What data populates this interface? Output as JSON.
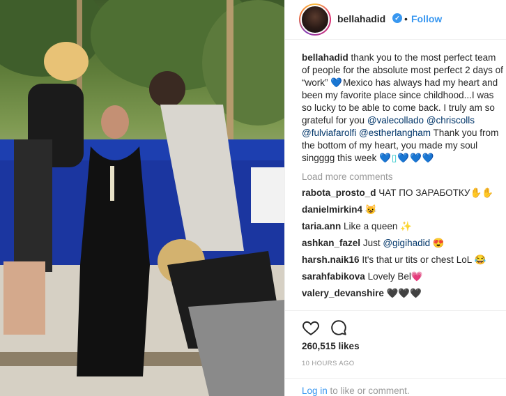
{
  "post": {
    "username": "bellahadid",
    "verified_mark": "✓",
    "separator": "•",
    "follow_label": "Follow",
    "caption": {
      "username": "bellahadid",
      "text_before": " thank you to the most perfect team of people for the absolute most perfect 2 days of “work” ",
      "heart_1": "💙",
      "text_middle": "Mexico has always had my heart and been my favorite place since childhood...I was so lucky to be able to come back. I truly am so grateful for you ",
      "mentions": [
        "@valecollado",
        "@chriscolls",
        "@fulviafarolfi",
        "@estherlangham"
      ],
      "text_after": " Thank you from the bottom of my heart, you made my soul singggg this week ",
      "hearts_end": "💙▯💙💙💙"
    },
    "load_more_label": "Load more comments",
    "comments": [
      {
        "user": "rabota_prosto_d",
        "text": "ЧАТ ПО ЗАРАБОТКУ",
        "emoji": "✋✋",
        "mention": ""
      },
      {
        "user": "danielmirkin4",
        "text": "",
        "emoji": "😺",
        "mention": ""
      },
      {
        "user": "taria.ann",
        "text": "Like a queen",
        "emoji": "✨",
        "mention": ""
      },
      {
        "user": "ashkan_fazel",
        "text": "Just",
        "emoji": "😍",
        "mention": "@gigihadid"
      },
      {
        "user": "harsh.naik16",
        "text": "It's that ur tits or chest LoL",
        "emoji": "😂",
        "mention": ""
      },
      {
        "user": "sarahfabikova",
        "text": "Lovely Bel",
        "emoji": "💗",
        "mention": ""
      },
      {
        "user": "valery_devanshire",
        "text": "",
        "emoji": "🖤🖤🖤",
        "mention": ""
      }
    ],
    "likes": "260,515 likes",
    "time": "10 HOURS AGO",
    "login": {
      "link": "Log in",
      "rest": " to like or comment."
    },
    "icons": {
      "like": "heart-outline",
      "comment": "speech-bubble"
    },
    "colors": {
      "accent": "#3897f0",
      "heart": "#18c1c4",
      "mention": "#003569",
      "muted": "#999999"
    }
  }
}
